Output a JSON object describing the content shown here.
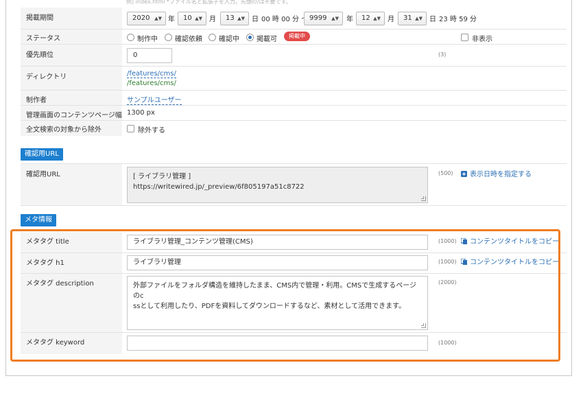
{
  "hint_text": "例) index.html *ファイル名と拡張子を入力。先頭の/は不要です。",
  "period": {
    "label": "掲載期間",
    "start_year": "2020",
    "start_month": "10",
    "start_day": "13",
    "year_unit": "年",
    "month_unit": "月",
    "day_unit": "日",
    "start_time": "00 時 00 分 〜",
    "end_year": "9999",
    "end_month": "12",
    "end_day": "31",
    "end_time": "23 時 59 分"
  },
  "status": {
    "label": "ステータス",
    "options": [
      "制作中",
      "確認依頼",
      "確認中",
      "掲載可"
    ],
    "selected": "掲載可",
    "badge": "掲載中",
    "hide_label": "非表示"
  },
  "priority": {
    "label": "優先順位",
    "value": "0",
    "count": "(3)"
  },
  "directory": {
    "label": "ディレクトリ",
    "link": "/features/cms/",
    "path": "/features/cms/"
  },
  "author": {
    "label": "制作者",
    "value": "サンプルユーザー"
  },
  "admin_width": {
    "label": "管理画面のコンテンツページ幅",
    "value": "1300 px"
  },
  "fulltext": {
    "label": "全文検索の対象から除外",
    "checkbox_label": "除外する"
  },
  "preview_section": {
    "title": "確認用URL",
    "label": "確認用URL",
    "line1": "[ ライブラリ管理 ]",
    "line2": "https://writewired.jp/_preview/6f805197a51c8722",
    "count": "(500)",
    "action": "表示日時を指定する"
  },
  "meta_section": {
    "title": "メタ情報",
    "title_tag": {
      "label": "メタタグ title",
      "value": "ライブラリ管理_コンテンツ管理(CMS)",
      "count": "(1000)",
      "action": "コンテンツタイトルをコピー"
    },
    "h1_tag": {
      "label": "メタタグ h1",
      "value": "ライブラリ管理",
      "count": "(1000)",
      "action": "コンテンツタイトルをコピー"
    },
    "description": {
      "label": "メタタグ description",
      "line1": "外部ファイルをフォルダ構造を維持したまま、CMS内で管理・利用。CMSで生成するページのc",
      "line2": "ssとして利用したり、PDFを資料してダウンロードするなど、素材として活用できます。",
      "count": "(2000)"
    },
    "keyword": {
      "label": "メタタグ keyword",
      "value": "",
      "count": "(1000)"
    }
  },
  "colors": {
    "accent": "#1d7fcf",
    "link": "#2c6fb6",
    "highlight": "#ef7d21",
    "badge": "#e24b4b",
    "path_green": "#2e7d2e"
  }
}
